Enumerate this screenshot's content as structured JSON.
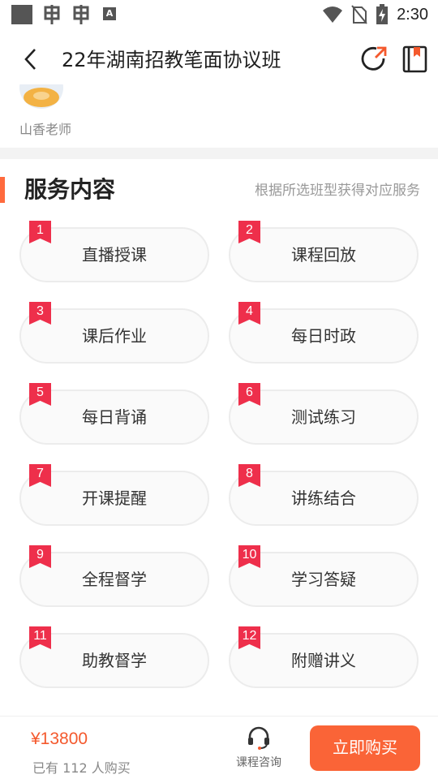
{
  "status_bar": {
    "time": "2:30",
    "notification_icons": [
      "square-icon",
      "bug-icon",
      "bug-icon",
      "a-box-icon"
    ],
    "system_icons": [
      "wifi-icon",
      "no-sim-icon",
      "battery-charging-icon"
    ]
  },
  "header": {
    "title": "22年湖南招教笔面协议班",
    "icons": [
      "back-arrow-icon",
      "share-refresh-icon",
      "bookmark-icon"
    ]
  },
  "teacher": {
    "name": "山香老师"
  },
  "services": {
    "title": "服务内容",
    "note": "根据所选班型获得对应服务",
    "items": [
      {
        "num": "1",
        "label": "直播授课"
      },
      {
        "num": "2",
        "label": "课程回放"
      },
      {
        "num": "3",
        "label": "课后作业"
      },
      {
        "num": "4",
        "label": "每日时政"
      },
      {
        "num": "5",
        "label": "每日背诵"
      },
      {
        "num": "6",
        "label": "测试练习"
      },
      {
        "num": "7",
        "label": "开课提醒"
      },
      {
        "num": "8",
        "label": "讲练结合"
      },
      {
        "num": "9",
        "label": "全程督学"
      },
      {
        "num": "10",
        "label": "学习答疑"
      },
      {
        "num": "11",
        "label": "助教督学"
      },
      {
        "num": "12",
        "label": "附赠讲义"
      }
    ]
  },
  "bottom": {
    "price": "¥13800",
    "buyers": "已有 112 人购买",
    "consult_label": "课程咨询",
    "buy_label": "立即购买"
  },
  "colors": {
    "accent": "#fa6437",
    "flag": "#ee2f4b",
    "price": "#f4592d"
  }
}
